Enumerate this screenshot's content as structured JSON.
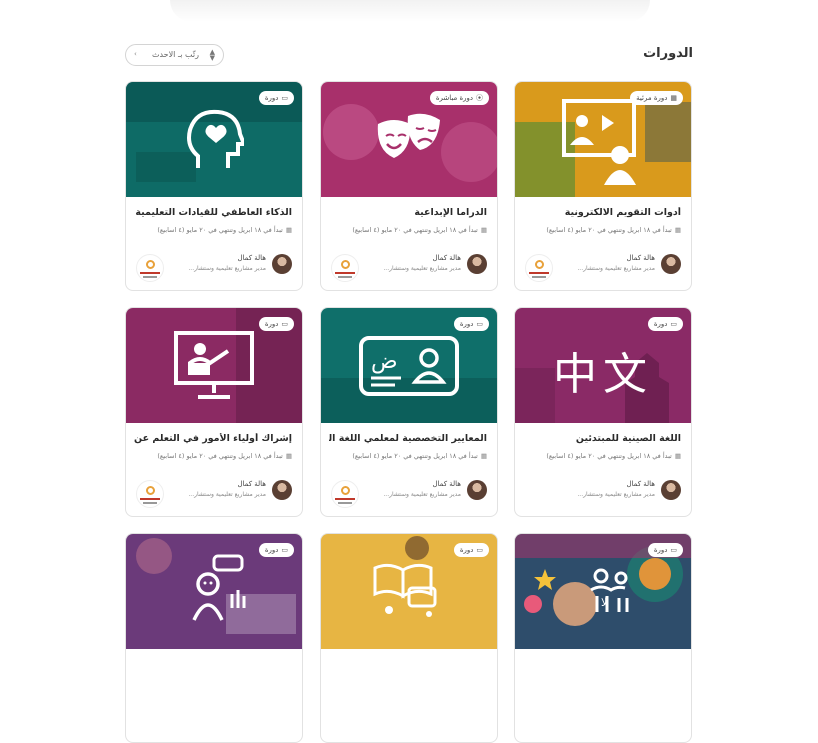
{
  "header": {
    "title": "الدورات",
    "sort_label": "رتّب بـ الاحدث"
  },
  "cards": [
    {
      "title": "أدوات التقويم الالكترونية",
      "badge": "دورة مرئية",
      "badge_icon": "calendar-icon",
      "dates": "تبدأ في ١٨ ابريل وتنتهي في ٢٠ مايو (٤ اسابيع)",
      "author": "هالة كمال",
      "role": "مدير مشاريع تعليمية وستشار...",
      "color": "#d99a1c",
      "art": "presentation-icon"
    },
    {
      "title": "الدراما الإبداعية",
      "badge": "دورة مباشرة",
      "badge_icon": "live-icon",
      "dates": "تبدأ في ١٨ ابريل وتنتهي في ٢٠ مايو (٤ اسابيع)",
      "author": "هالة كمال",
      "role": "مدير مشاريع تعليمية وستشار...",
      "color": "#a8306b",
      "art": "theater-masks-icon"
    },
    {
      "title": "الذكاء العاطفي للقيادات التعليمية",
      "badge": "دورة",
      "badge_icon": "laptop-icon",
      "dates": "تبدأ في ١٨ ابريل وتنتهي في ٢٠ مايو (٤ اسابيع)",
      "author": "هالة كمال",
      "role": "مدير مشاريع تعليمية وستشار...",
      "color": "#0e6b66",
      "art": "head-heart-icon"
    },
    {
      "title": "اللغة الصينية للمبتدئين",
      "badge": "دورة",
      "badge_icon": "laptop-icon",
      "dates": "تبدأ في ١٨ ابريل وتنتهي في ٢٠ مايو (٤ اسابيع)",
      "author": "هالة كمال",
      "role": "مدير مشاريع تعليمية وستشار...",
      "color": "#8a2a66",
      "art_text": "中文"
    },
    {
      "title": "المعايير التخصصية لمعلمي اللغة العربية",
      "badge": "دورة",
      "badge_icon": "laptop-icon",
      "dates": "تبدأ في ١٨ ابريل وتنتهي في ٢٠ مايو (٤ اسابيع)",
      "author": "هالة كمال",
      "role": "مدير مشاريع تعليمية وستشار...",
      "color": "#0f6f6a",
      "art": "arabic-id-card-icon"
    },
    {
      "title": "إشراك أولياء الأمور في التعلم عن بعد",
      "badge": "دورة",
      "badge_icon": "laptop-icon",
      "dates": "تبدأ في ١٨ ابريل وتنتهي في ٢٠ مايو (٤ اسابيع)",
      "author": "هالة كمال",
      "role": "مدير مشاريع تعليمية وستشار...",
      "color": "#8b2a63",
      "art": "teacher-screen-icon"
    },
    {
      "badge": "دورة",
      "badge_icon": "laptop-icon",
      "color": "#6b3a7a",
      "art": "kids-icon"
    },
    {
      "badge": "دورة",
      "badge_icon": "laptop-icon",
      "color": "#e1a92a",
      "art": "online-book-icon"
    },
    {
      "badge": "دورة",
      "badge_icon": "laptop-icon",
      "color": "#2e4d6b",
      "art": "person-child-icon",
      "art_text": "لا"
    }
  ]
}
